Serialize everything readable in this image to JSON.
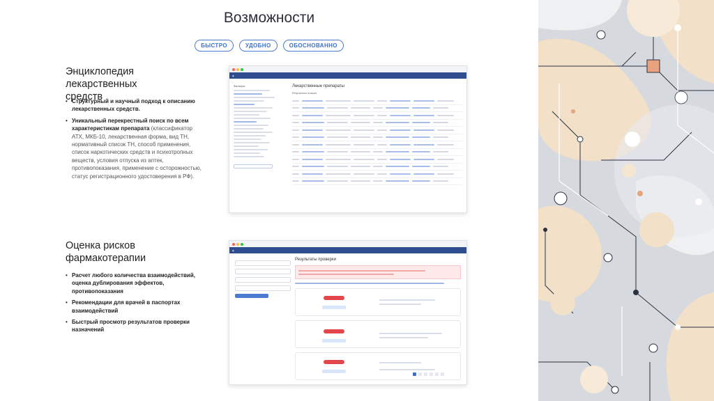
{
  "title": "Возможности",
  "pills": [
    "БЫСТРО",
    "УДОБНО",
    "ОБОСНОВАННО"
  ],
  "section1": {
    "title": "Энциклопедия лекарственных средств",
    "bullets": [
      {
        "bold": "Структурный и научный подход к описанию лекарственных средств.",
        "rest": ""
      },
      {
        "bold": "Уникальный перекрестный поиск по всем характеристикам препарата",
        "rest": " (классификатор АТХ, МКБ-10, лекарственная форма, вид ТН, нормативный список ТН, способ применения, список наркотических средств и психотропных веществ, условия отпуска из аптек, противопоказания, применение с осторожностью, статус регистрационного удостоверения в РФ)."
      }
    ]
  },
  "section2": {
    "title": "Оценка рисков фармакотерапии",
    "bullets": [
      {
        "bold": "Расчет любого количества взаимодействий, оценка дублирования эффектов, противопоказания",
        "rest": ""
      },
      {
        "bold": "Рекомендации для врачей в паспортах взаимодействий",
        "rest": ""
      },
      {
        "bold": "Быстрый просмотр результатов проверки назначений",
        "rest": ""
      }
    ]
  },
  "window1": {
    "heading": "Лекарственные препараты",
    "subheading": "Результаты поиска",
    "filters_heading": "Фильтры"
  },
  "window2": {
    "heading": "Результаты проверки"
  },
  "colors": {
    "accent": "#3e6fc8",
    "nav": "#2f4c8f",
    "alert": "#e2474b",
    "deco_bg": "#d6d9de",
    "deco_peach": "#f2e0c8",
    "deco_orange": "#e8a27c",
    "deco_navy": "#2c3140"
  }
}
